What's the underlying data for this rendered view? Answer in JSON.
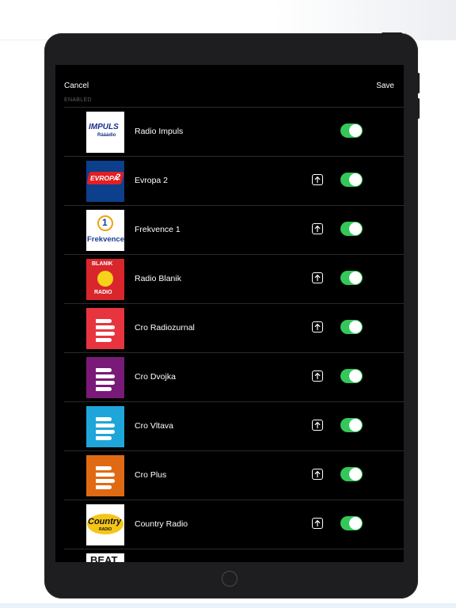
{
  "nav": {
    "cancel_label": "Cancel",
    "save_label": "Save"
  },
  "section_label": "ENABLED",
  "stations": [
    {
      "name": "Radio Impuls",
      "logo": "impuls",
      "logo_text": "IMPULS",
      "logo_sub": "Rááádio",
      "reorderable": false,
      "enabled": true
    },
    {
      "name": "Evropa 2",
      "logo": "evropa2",
      "logo_text": "EVROPA",
      "logo_sub": "2",
      "reorderable": true,
      "enabled": true
    },
    {
      "name": "Frekvence 1",
      "logo": "frekvence1",
      "logo_text": "Frekvence",
      "logo_sub": "1",
      "reorderable": true,
      "enabled": true
    },
    {
      "name": "Radio Blanik",
      "logo": "blanik",
      "logo_text": "BLANIK",
      "logo_sub": "RADIO",
      "reorderable": true,
      "enabled": true
    },
    {
      "name": "Cro Radiozurnal",
      "logo": "cro",
      "color": "#e8343f",
      "reorderable": true,
      "enabled": true
    },
    {
      "name": "Cro Dvojka",
      "logo": "cro",
      "color": "#7a1a78",
      "reorderable": true,
      "enabled": true
    },
    {
      "name": "Cro Vltava",
      "logo": "cro",
      "color": "#1ea6db",
      "reorderable": true,
      "enabled": true
    },
    {
      "name": "Cro Plus",
      "logo": "cro",
      "color": "#e06a13",
      "reorderable": true,
      "enabled": true
    },
    {
      "name": "Country Radio",
      "logo": "country",
      "logo_text": "Country",
      "logo_sub": "RADIO",
      "reorderable": true,
      "enabled": true
    },
    {
      "name": "",
      "logo": "beat",
      "logo_text": "BEAT",
      "reorderable": false,
      "enabled": false
    }
  ],
  "icons": {
    "reorder": "move-to-top-icon",
    "toggle": "enabled-toggle",
    "home": "home-button"
  },
  "colors": {
    "toggle_on": "#34c759",
    "screen_bg": "#000000",
    "separator": "#2b2b2d"
  }
}
